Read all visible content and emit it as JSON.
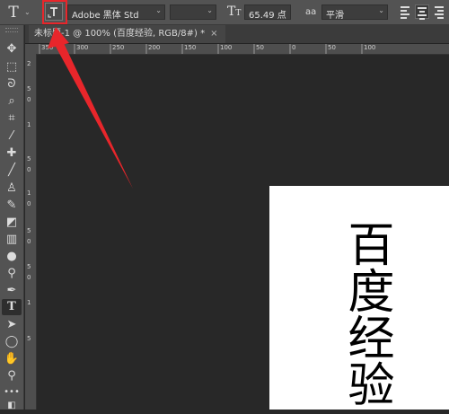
{
  "options_bar": {
    "tool_glyph": "T",
    "font_family": "Adobe 黑体 Std",
    "font_size": "65.49 点",
    "font_size_icon_glyph": "T",
    "antialias_icon": "aa",
    "antialias": "平滑",
    "icons": [
      "text-tool-icon",
      "text-orientation-icon",
      "font-size-icon",
      "antialias-icon",
      "align-left-icon",
      "align-center-icon",
      "align-right-icon"
    ]
  },
  "document_tab": {
    "title": "未标题-1 @ 100% (百度经验, RGB/8#) *",
    "close": "×"
  },
  "ruler": {
    "top_labels": [
      "350",
      "300",
      "250",
      "200",
      "150",
      "100",
      "50",
      "0",
      "50",
      "100"
    ],
    "left_labels": [
      "2",
      "5",
      "0",
      "1",
      "5",
      "0",
      "1",
      "0",
      "5",
      "0",
      "5",
      "0",
      "1",
      "5"
    ]
  },
  "canvas": {
    "text_layer": "百度经验"
  },
  "annotation": {
    "highlight_color": "#e8262b"
  },
  "toolbox": {
    "tools": [
      "move-icon",
      "marquee-icon",
      "lasso-icon",
      "quick-select-icon",
      "crop-icon",
      "eyedropper-icon",
      "healing-brush-icon",
      "brush-icon",
      "clone-stamp-icon",
      "history-brush-icon",
      "eraser-icon",
      "gradient-icon",
      "blur-icon",
      "dodge-icon",
      "pen-icon",
      "type-icon",
      "path-select-icon",
      "ellipse-icon",
      "hand-icon",
      "zoom-icon",
      "more-tools-icon",
      "default-colors-icon"
    ],
    "active_tool": "type-icon"
  }
}
